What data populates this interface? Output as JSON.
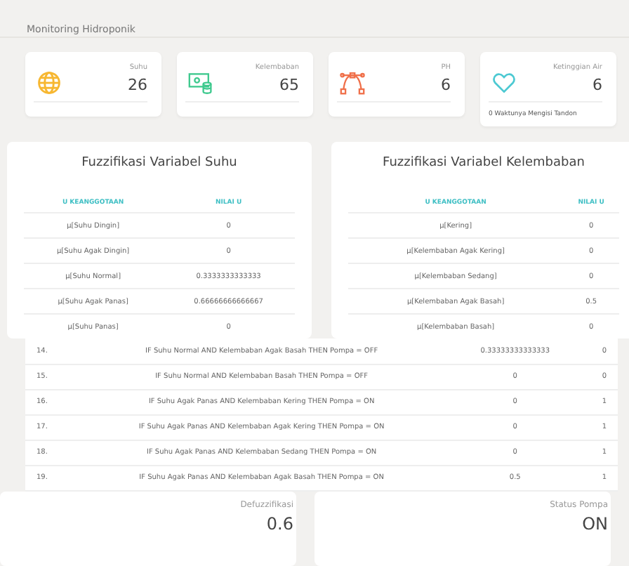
{
  "header": {
    "title": "Monitoring Hidroponik"
  },
  "stats": [
    {
      "kind": "globe",
      "label": "Suhu",
      "value": "26"
    },
    {
      "kind": "money",
      "label": "Kelembaban",
      "value": "65"
    },
    {
      "kind": "curve",
      "label": "PH",
      "value": "6"
    },
    {
      "kind": "heart",
      "label": "Ketinggian Air",
      "value": "6",
      "footer": "0 Waktunya Mengisi Tandon"
    }
  ],
  "fuzzy": [
    {
      "title": "Fuzzifikasi Variabel Suhu",
      "columns": [
        "U KEANGGOTAAN",
        "NILAI U"
      ],
      "rows": [
        [
          "μ[Suhu Dingin]",
          "0"
        ],
        [
          "μ[Suhu Agak Dingin]",
          "0"
        ],
        [
          "μ[Suhu Normal]",
          "0.3333333333333"
        ],
        [
          "μ[Suhu Agak Panas]",
          "0.66666666666667"
        ],
        [
          "μ[Suhu Panas]",
          "0"
        ]
      ]
    },
    {
      "title": "Fuzzifikasi Variabel Kelembaban",
      "columns": [
        "U KEANGGOTAAN",
        "NILAI U"
      ],
      "rows": [
        [
          "μ[Kering]",
          "0"
        ],
        [
          "μ[Kelembaban Agak Kering]",
          "0"
        ],
        [
          "μ[Kelembaban Sedang]",
          "0"
        ],
        [
          "μ[Kelembaban Agak Basah]",
          "0.5"
        ],
        [
          "μ[Kelembaban Basah]",
          "0"
        ]
      ]
    }
  ],
  "rules": [
    [
      "14.",
      "IF Suhu Normal AND Kelembaban Agak Basah THEN Pompa = OFF",
      "0.33333333333333",
      "0"
    ],
    [
      "15.",
      "IF Suhu Normal AND Kelembaban Basah THEN Pompa = OFF",
      "0",
      "0"
    ],
    [
      "16.",
      "IF Suhu Agak Panas AND Kelembaban Kering THEN Pompa = ON",
      "0",
      "1"
    ],
    [
      "17.",
      "IF Suhu Agak Panas AND Kelembaban Agak Kering THEN Pompa = ON",
      "0",
      "1"
    ],
    [
      "18.",
      "IF Suhu Agak Panas AND Kelembaban Sedang THEN Pompa = ON",
      "0",
      "1"
    ],
    [
      "19.",
      "IF Suhu Agak Panas AND Kelembaban Agak Basah THEN Pompa = ON",
      "0.5",
      "1"
    ]
  ],
  "results": [
    {
      "label": "Defuzzifikasi",
      "value": "0.6"
    },
    {
      "label": "Status Pompa",
      "value": "ON"
    }
  ]
}
